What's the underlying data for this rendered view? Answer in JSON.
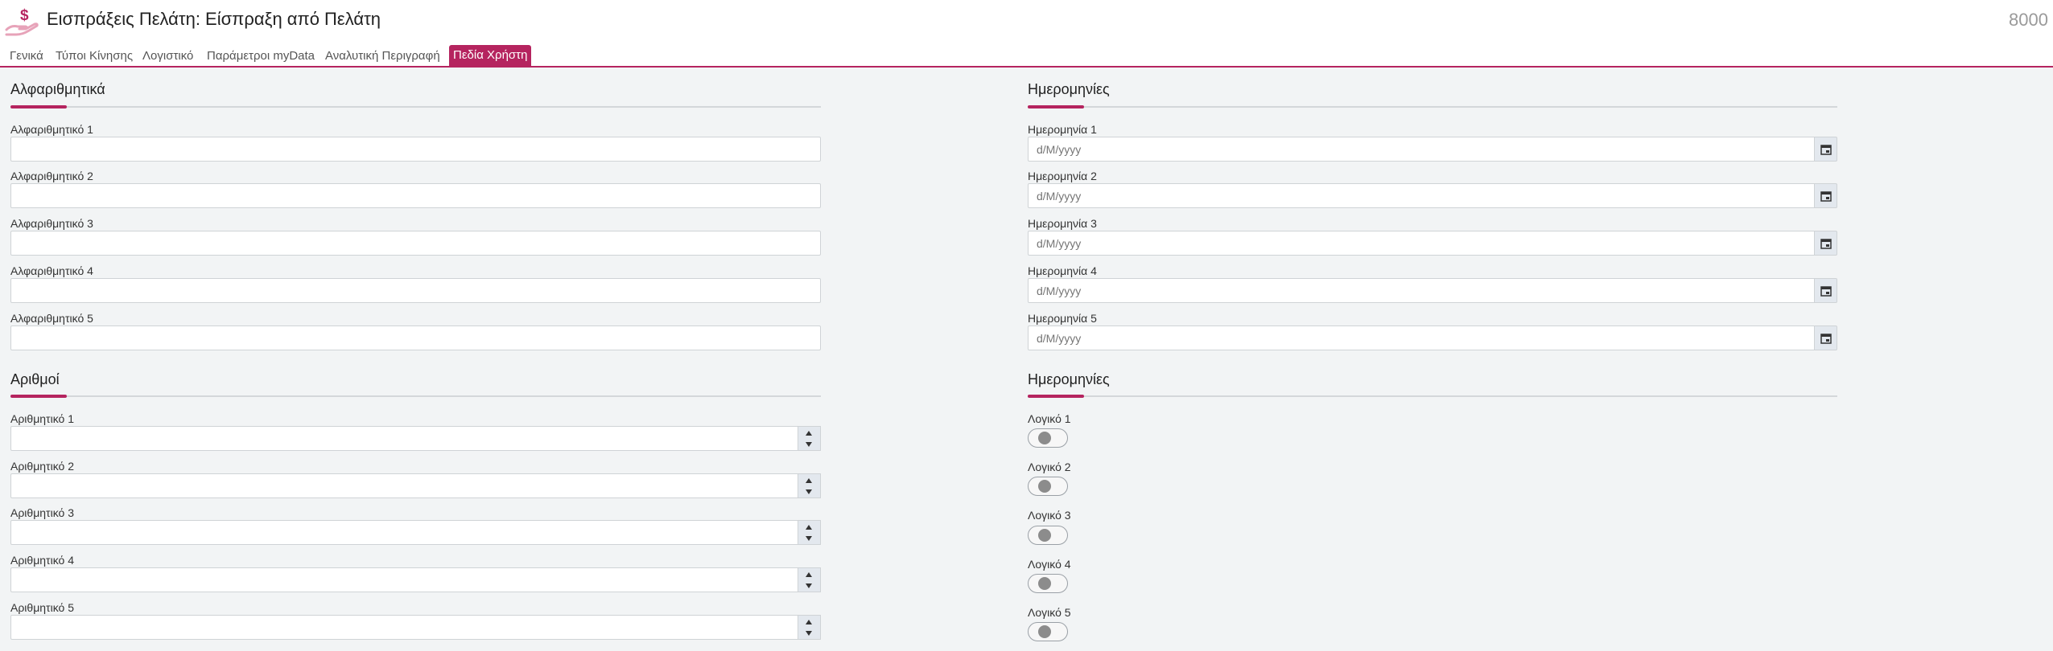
{
  "header": {
    "title": "Εισπράξεις Πελάτη: Είσπραξη από Πελάτη",
    "code": "8000",
    "icon": "hand-dollar-icon"
  },
  "tabs": [
    {
      "label": "Γενικά",
      "active": false
    },
    {
      "label": "Τύποι Κίνησης",
      "active": false
    },
    {
      "label": "Λογιστικό",
      "active": false
    },
    {
      "label": "Παράμετροι myData",
      "active": false
    },
    {
      "label": "Αναλυτική Περιγραφή",
      "active": false
    },
    {
      "label": "Πεδία Χρήστη",
      "active": true
    }
  ],
  "sections": {
    "alpha": {
      "title": "Αλφαριθμητικά",
      "fields": [
        {
          "label": "Αλφαριθμητικό 1",
          "value": ""
        },
        {
          "label": "Αλφαριθμητικό 2",
          "value": ""
        },
        {
          "label": "Αλφαριθμητικό 3",
          "value": ""
        },
        {
          "label": "Αλφαριθμητικό 4",
          "value": ""
        },
        {
          "label": "Αλφαριθμητικό 5",
          "value": ""
        }
      ]
    },
    "dates": {
      "title": "Ημερομηνίες",
      "placeholder": "d/M/yyyy",
      "fields": [
        {
          "label": "Ημερομηνία 1",
          "value": ""
        },
        {
          "label": "Ημερομηνία 2",
          "value": ""
        },
        {
          "label": "Ημερομηνία 3",
          "value": ""
        },
        {
          "label": "Ημερομηνία 4",
          "value": ""
        },
        {
          "label": "Ημερομηνία 5",
          "value": ""
        }
      ]
    },
    "numbers": {
      "title": "Αριθμοί",
      "fields": [
        {
          "label": "Αριθμητικό 1",
          "value": ""
        },
        {
          "label": "Αριθμητικό 2",
          "value": ""
        },
        {
          "label": "Αριθμητικό 3",
          "value": ""
        },
        {
          "label": "Αριθμητικό 4",
          "value": ""
        },
        {
          "label": "Αριθμητικό 5",
          "value": ""
        }
      ]
    },
    "booleans": {
      "title": "Ημερομηνίες",
      "fields": [
        {
          "label": "Λογικό 1",
          "checked": false
        },
        {
          "label": "Λογικό 2",
          "checked": false
        },
        {
          "label": "Λογικό 3",
          "checked": false
        },
        {
          "label": "Λογικό 4",
          "checked": false
        },
        {
          "label": "Λογικό 5",
          "checked": false
        }
      ]
    }
  },
  "colors": {
    "accent": "#b5245f",
    "background": "#f2f4f5"
  }
}
